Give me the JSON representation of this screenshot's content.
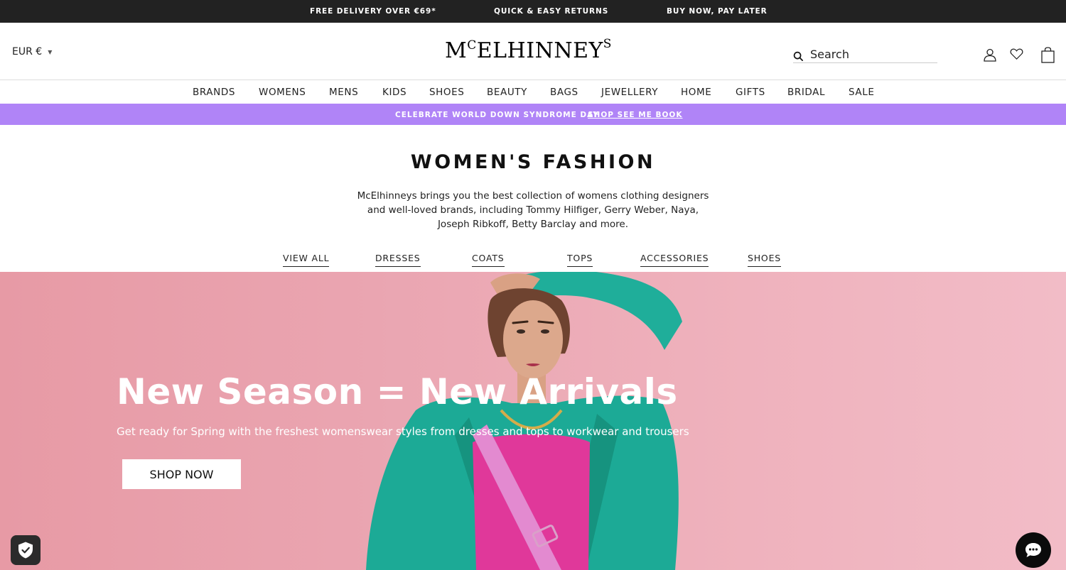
{
  "topbar": {
    "messages": [
      "FREE DELIVERY OVER €69*",
      "QUICK & EASY RETURNS",
      "BUY NOW, PAY LATER"
    ]
  },
  "header": {
    "currency": "EUR €",
    "logo_main": "M",
    "logo_c": "C",
    "logo_rest": "ELHINNEY",
    "logo_s": "S",
    "search_placeholder": "Search",
    "icons": [
      "user-icon",
      "heart-icon",
      "bag-icon"
    ]
  },
  "nav": {
    "items": [
      "BRANDS",
      "WOMENS",
      "MENS",
      "KIDS",
      "SHOES",
      "BEAUTY",
      "BAGS",
      "JEWELLERY",
      "HOME",
      "GIFTS",
      "BRIDAL",
      "SALE"
    ]
  },
  "promo": {
    "message": "CELEBRATE WORLD DOWN SYNDROME DAY",
    "link": "SHOP SEE ME BOOK",
    "color": "#b084f7"
  },
  "intro": {
    "title": "WOMEN'S FASHION",
    "description": "McElhinneys brings you the best collection of womens clothing designers and well-loved brands, including Tommy Hilfiger, Gerry Weber, Naya, Joseph Ribkoff, Betty Barclay and more."
  },
  "categories": [
    "VIEW ALL",
    "DRESSES",
    "COATS",
    "TOPS",
    "ACCESSORIES",
    "SHOES"
  ],
  "hero": {
    "heading": "New Season = New Arrivals",
    "subheading": "Get ready for Spring with the freshest womenswear styles from dresses and tops to workwear and trousers",
    "button": "SHOP NOW",
    "background_color": "#eaa5b1"
  },
  "widgets": {
    "privacy": "shield-check-icon",
    "chat": "chat-bubble-icon"
  }
}
